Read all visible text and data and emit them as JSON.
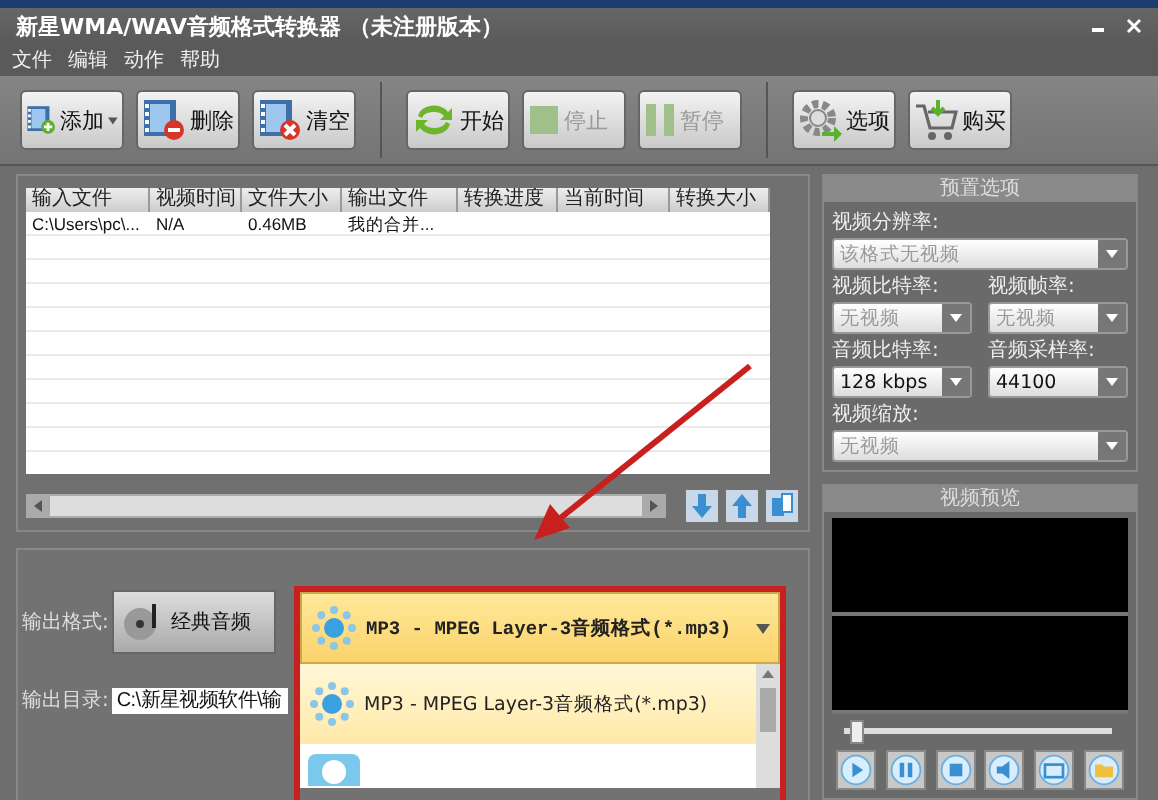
{
  "window": {
    "title": "新星WMA/WAV音频格式转换器 （未注册版本）"
  },
  "menu": [
    "文件",
    "编辑",
    "动作",
    "帮助"
  ],
  "toolbar": [
    {
      "kind": "add",
      "label": "添加",
      "disabled": false,
      "dropdown": true
    },
    {
      "kind": "delete",
      "label": "删除",
      "disabled": false,
      "dropdown": false
    },
    {
      "kind": "clear",
      "label": "清空",
      "disabled": false,
      "dropdown": false
    },
    {
      "kind": "start",
      "label": "开始",
      "disabled": false,
      "dropdown": false
    },
    {
      "kind": "stop",
      "label": "停止",
      "disabled": true,
      "dropdown": false
    },
    {
      "kind": "pause",
      "label": "暂停",
      "disabled": true,
      "dropdown": false
    },
    {
      "kind": "options",
      "label": "选项",
      "disabled": false,
      "dropdown": false
    },
    {
      "kind": "buy",
      "label": "购买",
      "disabled": false,
      "dropdown": false
    }
  ],
  "table": {
    "columns": [
      "输入文件",
      "视频时间",
      "文件大小",
      "输出文件",
      "转换进度",
      "当前时间",
      "转换大小"
    ],
    "rows": [
      [
        "C:\\Users\\pc\\...",
        "N/A",
        "0.46MB",
        "我的合并..."
      ]
    ]
  },
  "output": {
    "format_label": "输出格式:",
    "category": "经典音频",
    "format": "MP3 - MPEG Layer-3音频格式(*.mp3)",
    "dir_label": "输出目录:",
    "dir": "C:\\新星视频软件\\输",
    "options": [
      {
        "label": "MP3 - MPEG Layer-3音频格式(*.mp3)",
        "selected": true
      },
      {
        "kind": "picture",
        "selected": false
      }
    ]
  },
  "presets": {
    "title": "预置选项",
    "fields": [
      {
        "label": "视频分辨率:",
        "value": "该格式无视频",
        "disabled": true,
        "wide": true
      },
      {
        "label": "视频比特率:",
        "value": "无视频",
        "disabled": true,
        "wide": false
      },
      {
        "label": "视频帧率:",
        "value": "无视频",
        "disabled": true,
        "wide": false
      },
      {
        "label": "音频比特率:",
        "value": "128 kbps",
        "disabled": false,
        "wide": false
      },
      {
        "label": "音频采样率:",
        "value": "44100",
        "disabled": false,
        "wide": false
      },
      {
        "label": "视频缩放:",
        "value": "无视频",
        "disabled": true,
        "wide": true
      }
    ]
  },
  "preview": {
    "title": "视频预览",
    "seek": {
      "level": 0.02
    }
  }
}
